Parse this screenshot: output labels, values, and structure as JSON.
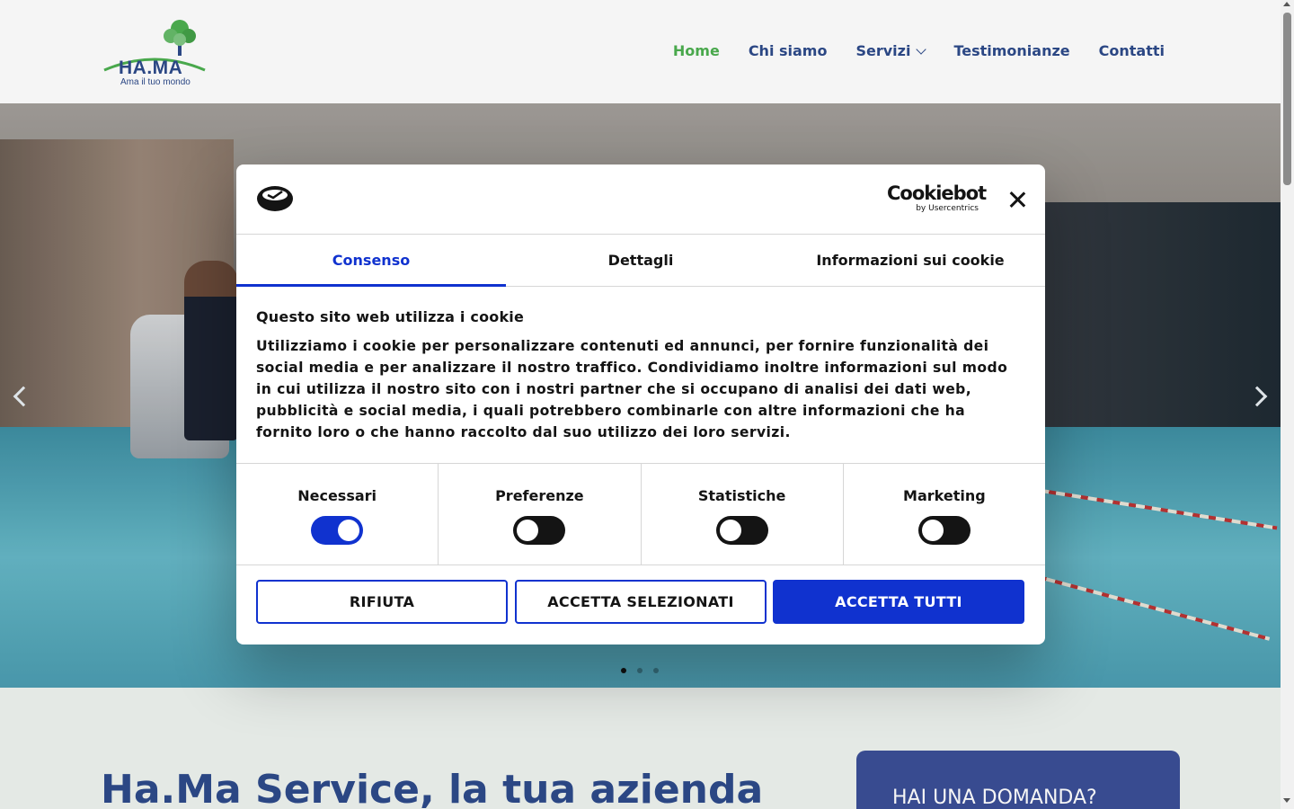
{
  "logo": {
    "name": "HA.MA",
    "tagline": "Ama il tuo mondo"
  },
  "nav": {
    "items": [
      {
        "label": "Home",
        "active": true
      },
      {
        "label": "Chi siamo"
      },
      {
        "label": "Servizi",
        "has_dropdown": true
      },
      {
        "label": "Testimonianze"
      },
      {
        "label": "Contatti"
      }
    ]
  },
  "hero": {
    "slide_count": 3,
    "active_slide": 1
  },
  "section": {
    "title": "Ha.Ma Service, la tua azienda",
    "question_box_title": "HAI UNA DOMANDA?"
  },
  "cookie": {
    "brand": "Cookiebot",
    "brand_sub": "by Usercentrics",
    "tabs": [
      "Consenso",
      "Dettagli",
      "Informazioni sui cookie"
    ],
    "title": "Questo sito web utilizza i cookie",
    "text": "Utilizziamo i cookie per personalizzare contenuti ed annunci, per fornire funzionalità dei social media e per analizzare il nostro traffico. Condividiamo inoltre informazioni sul modo in cui utilizza il nostro sito con i nostri partner che si occupano di analisi dei dati web, pubblicità e social media, i quali potrebbero combinarle con altre informazioni che ha fornito loro o che hanno raccolto dal suo utilizzo dei loro servizi.",
    "toggles": [
      {
        "label": "Necessari",
        "on": true
      },
      {
        "label": "Preferenze",
        "on": false
      },
      {
        "label": "Statistiche",
        "on": false
      },
      {
        "label": "Marketing",
        "on": false
      }
    ],
    "buttons": {
      "reject": "RIFIUTA",
      "accept_selected": "ACCETTA SELEZIONATI",
      "accept_all": "ACCETTA TUTTI"
    }
  },
  "colors": {
    "brand_blue": "#2d4a8a",
    "active_green": "#4caf50",
    "cookie_blue": "#1032cf"
  }
}
